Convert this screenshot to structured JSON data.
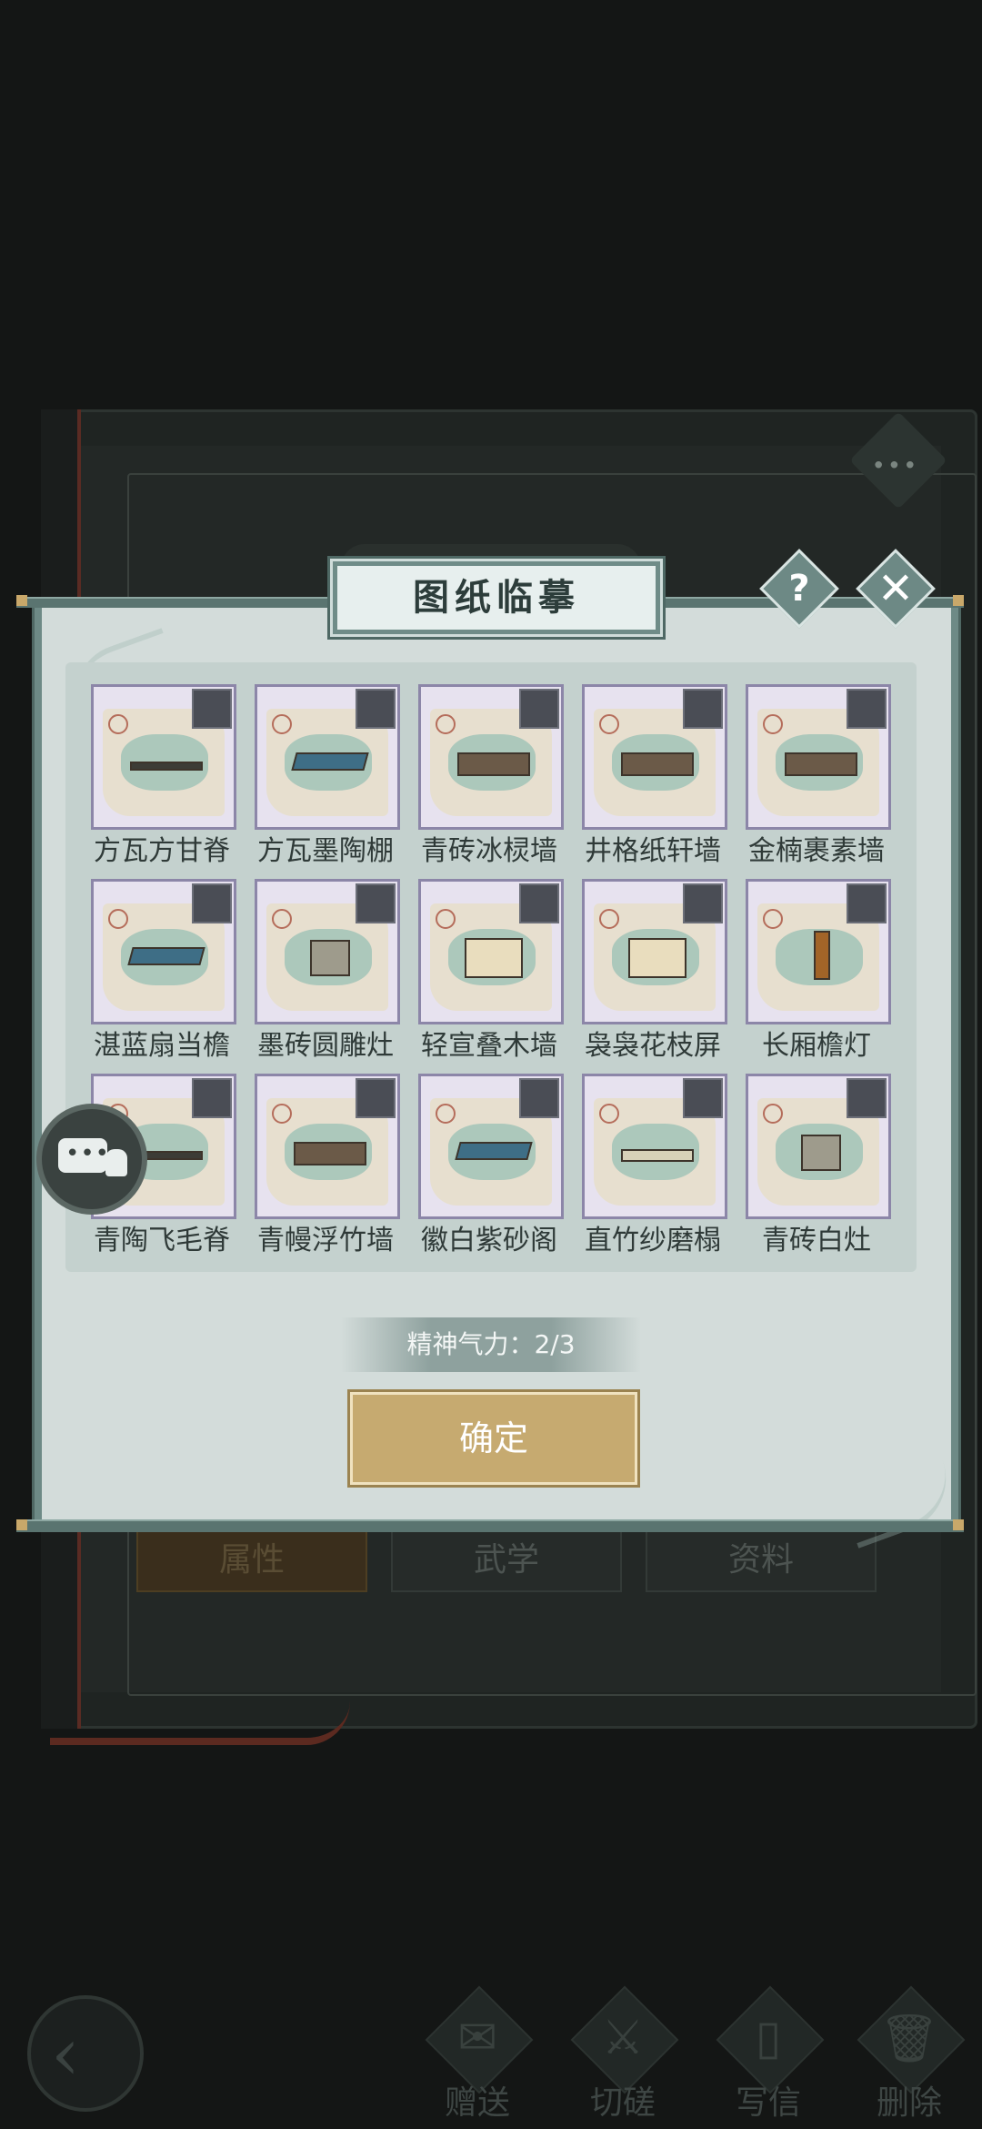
{
  "background": {
    "character_name": "",
    "tabs": [
      {
        "label": "属性",
        "active": true
      },
      {
        "label": "武学",
        "active": false
      },
      {
        "label": "资料",
        "active": false
      }
    ],
    "actions": [
      {
        "label": "赠送",
        "icon": "scroll-icon"
      },
      {
        "label": "切磋",
        "icon": "sword-icon"
      },
      {
        "label": "写信",
        "icon": "letter-icon"
      },
      {
        "label": "删除",
        "icon": "trash-icon"
      }
    ],
    "back_icon": "back-arrow-icon",
    "more_icon": "more-dots-icon"
  },
  "dialog": {
    "title": "图纸临摹",
    "help_glyph": "?",
    "close_glyph": "✕",
    "items": [
      {
        "name": "方瓦方甘脊",
        "model": "beam"
      },
      {
        "name": "方瓦墨陶棚",
        "model": "roof"
      },
      {
        "name": "青砖冰棂墙",
        "model": "wall"
      },
      {
        "name": "井格纸轩墙",
        "model": "wall"
      },
      {
        "name": "金楠裹素墙",
        "model": "wall"
      },
      {
        "name": "湛蓝扇当檐",
        "model": "roof"
      },
      {
        "name": "墨砖圆雕灶",
        "model": "stove"
      },
      {
        "name": "轻宣叠木墙",
        "model": "screen"
      },
      {
        "name": "袅袅花枝屏",
        "model": "screen"
      },
      {
        "name": "长厢檐灯",
        "model": "tall"
      },
      {
        "name": "青陶飞毛脊",
        "model": "beam"
      },
      {
        "name": "青幔浮竹墙",
        "model": "wall"
      },
      {
        "name": "徽白紫砂阁",
        "model": "roof"
      },
      {
        "name": "直竹纱磨榻",
        "model": "light"
      },
      {
        "name": "青砖白灶",
        "model": "stove"
      }
    ],
    "stamina_text": "精神气力：2/3",
    "confirm_label": "确定"
  },
  "chat_button": {
    "icon": "chat-bubble-icon",
    "glyph": "•••"
  },
  "colors": {
    "dialog_bg": "#d3dcda",
    "frame": "#6e8a86",
    "card_bg": "#e7e2ef",
    "confirm_bg": "#c6aa70"
  }
}
